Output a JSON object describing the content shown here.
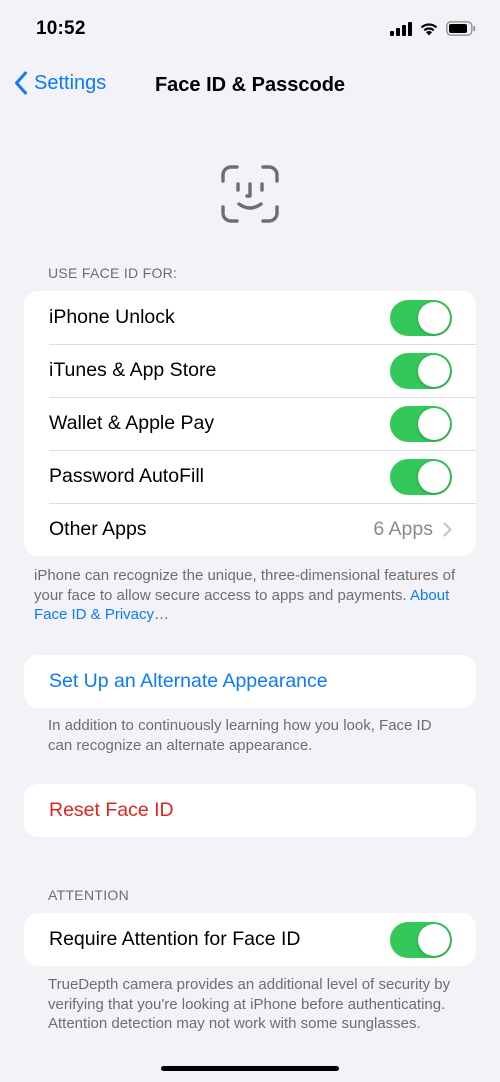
{
  "status_bar": {
    "time": "10:52"
  },
  "nav": {
    "back_label": "Settings",
    "title": "Face ID & Passcode"
  },
  "use_face_id": {
    "header": "USE FACE ID FOR:",
    "rows": [
      {
        "label": "iPhone Unlock",
        "on": true
      },
      {
        "label": "iTunes & App Store",
        "on": true
      },
      {
        "label": "Wallet & Apple Pay",
        "on": true
      },
      {
        "label": "Password AutoFill",
        "on": true
      }
    ],
    "other_apps": {
      "label": "Other Apps",
      "value": "6 Apps"
    },
    "footnote": "iPhone can recognize the unique, three-dimensional features of your face to allow secure access to apps and payments.",
    "footnote_link": "About Face ID & Privacy…"
  },
  "alternate": {
    "label": "Set Up an Alternate Appearance",
    "footnote": "In addition to continuously learning how you look, Face ID can recognize an alternate appearance."
  },
  "reset": {
    "label": "Reset Face ID"
  },
  "attention": {
    "header": "ATTENTION",
    "row": {
      "label": "Require Attention for Face ID",
      "on": true
    },
    "footnote": "TrueDepth camera provides an additional level of security by verifying that you're looking at iPhone before authenticating. Attention detection may not work with some sunglasses."
  },
  "colors": {
    "accent": "#0a7aff",
    "toggle_on": "#34c759",
    "destructive": "#e5231e",
    "background": "#f2f2f7"
  }
}
